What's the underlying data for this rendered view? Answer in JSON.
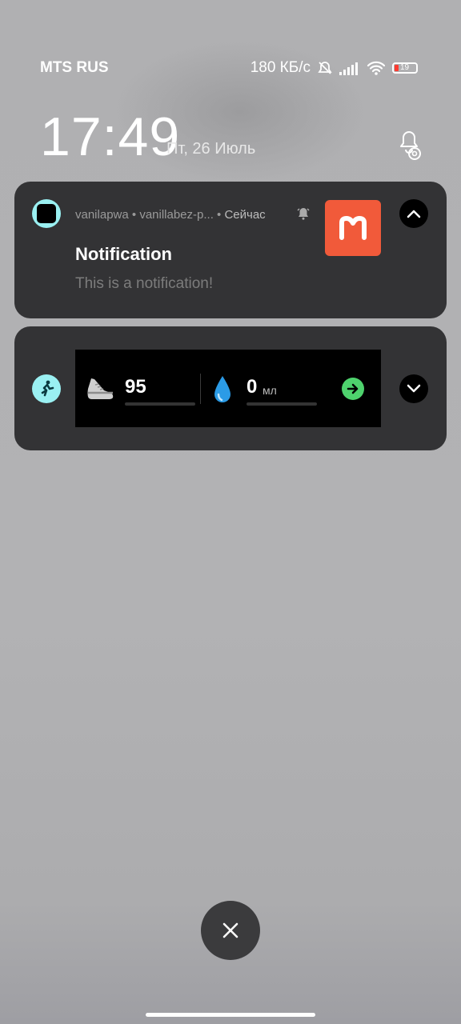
{
  "status_bar": {
    "carrier": "MTS RUS",
    "speed": "180 КБ/с",
    "battery": "19",
    "icons": [
      "mute-icon",
      "signal-icon",
      "wifi-icon",
      "battery-icon"
    ]
  },
  "lock": {
    "time": "17:49",
    "date": "Пт, 26 Июль"
  },
  "notification1": {
    "app": "vanilapwa",
    "sub": "vanillabez-p...",
    "time": "Сейчас",
    "title": "Notification",
    "body": "This is a notification!",
    "thumb_color": "#f15a3a"
  },
  "notification2": {
    "steps": "95",
    "water": "0",
    "water_unit": "мл",
    "accent": "#4ed26d"
  },
  "colors": {
    "app_icon": "#9af0f2",
    "card": "#333335"
  }
}
